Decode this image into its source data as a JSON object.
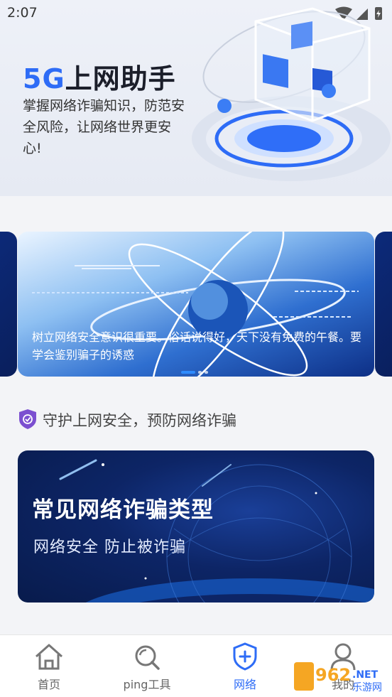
{
  "status_bar": {
    "time": "2:07"
  },
  "hero": {
    "title_accent": "5G",
    "title_rest": "上网助手",
    "subtitle": "掌握网络诈骗知识，防范安全风险，让网络世界更安心!"
  },
  "carousel": {
    "caption": "树立网络安全意识很重要。俗话说得好，天下没有免费的午餐。要学会鉴别骗子的诱惑",
    "dots": 3,
    "active_index": 0
  },
  "section": {
    "title": "守护上网安全，预防网络诈骗"
  },
  "fraud_card": {
    "title": "常见网络诈骗类型",
    "subtitle": "网络安全 防止被诈骗"
  },
  "tabs": [
    {
      "label": "首页",
      "icon": "home-icon"
    },
    {
      "label": "ping工具",
      "icon": "search-icon"
    },
    {
      "label": "网络",
      "icon": "shield-plus-icon",
      "active": true
    },
    {
      "label": "我的",
      "icon": "user-icon"
    }
  ],
  "watermark": {
    "text": "962.NET",
    "sub": "乐游网"
  },
  "colors": {
    "accent": "#2e6cf6",
    "card_dark": "#0d2566",
    "shield_purple": "#7b4fd0"
  }
}
